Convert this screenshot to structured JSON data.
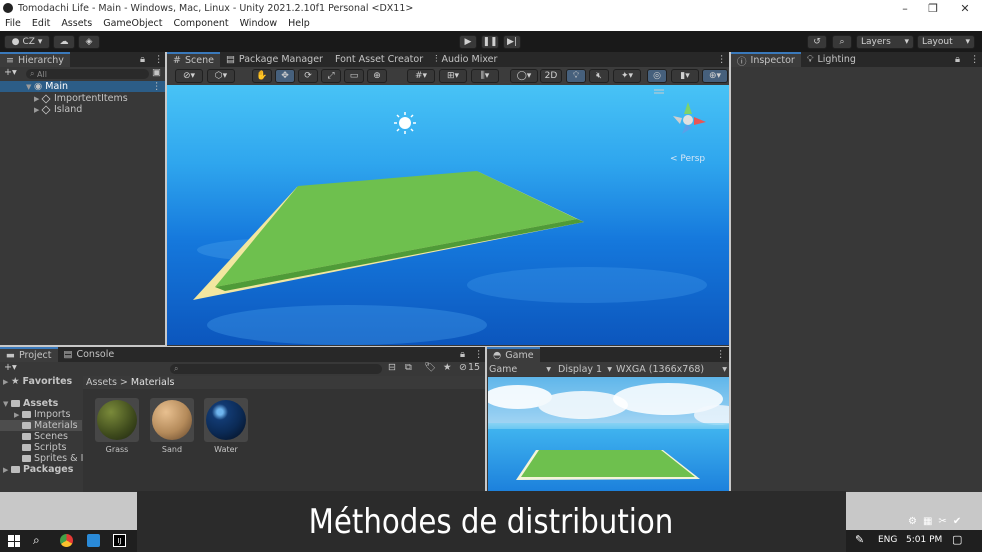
{
  "window": {
    "title": "Tomodachi Life - Main - Windows, Mac, Linux - Unity 2021.2.10f1 Personal <DX11>"
  },
  "menu": [
    "File",
    "Edit",
    "Assets",
    "GameObject",
    "Component",
    "Window",
    "Help"
  ],
  "toolbar": {
    "account": "CZ",
    "layers": "Layers",
    "layout": "Layout"
  },
  "hierarchy": {
    "tab": "Hierarchy",
    "search_placeholder": "All",
    "items": [
      {
        "label": "Main",
        "expanded": true,
        "depth": 0
      },
      {
        "label": "ImportentItems",
        "expanded": false,
        "depth": 1
      },
      {
        "label": "Island",
        "expanded": false,
        "depth": 1
      }
    ]
  },
  "scene_tabs": [
    "Scene",
    "Package Manager",
    "Font Asset Creator",
    "Audio Mixer"
  ],
  "scene": {
    "toggle_2d": "2D",
    "persp_label": "< Persp"
  },
  "inspector_tabs": [
    "Inspector",
    "Lighting"
  ],
  "project_tabs": [
    "Project",
    "Console"
  ],
  "project": {
    "favorites": "Favorites",
    "assets": "Assets",
    "asset_folders": [
      "Imports",
      "Materials",
      "Scenes",
      "Scripts",
      "Sprites & Im"
    ],
    "packages": "Packages",
    "breadcrumb": [
      "Assets",
      "Materials"
    ],
    "hidden_count": "15",
    "materials": [
      {
        "name": "Grass",
        "color": "#3e4a1c"
      },
      {
        "name": "Sand",
        "color": "#b48a5a"
      },
      {
        "name": "Water",
        "color": "#0b2a55"
      }
    ]
  },
  "game": {
    "tab": "Game",
    "mode": "Game",
    "display": "Display 1",
    "resolution": "WXGA (1366x768)"
  },
  "caption": "Méthodes de distribution",
  "taskbar": {
    "lang": "ENG",
    "time": "5:01 PM"
  },
  "colors": {
    "accent": "#3a79bb",
    "grass": "#6ec04e",
    "sand": "#f2e7a0"
  }
}
